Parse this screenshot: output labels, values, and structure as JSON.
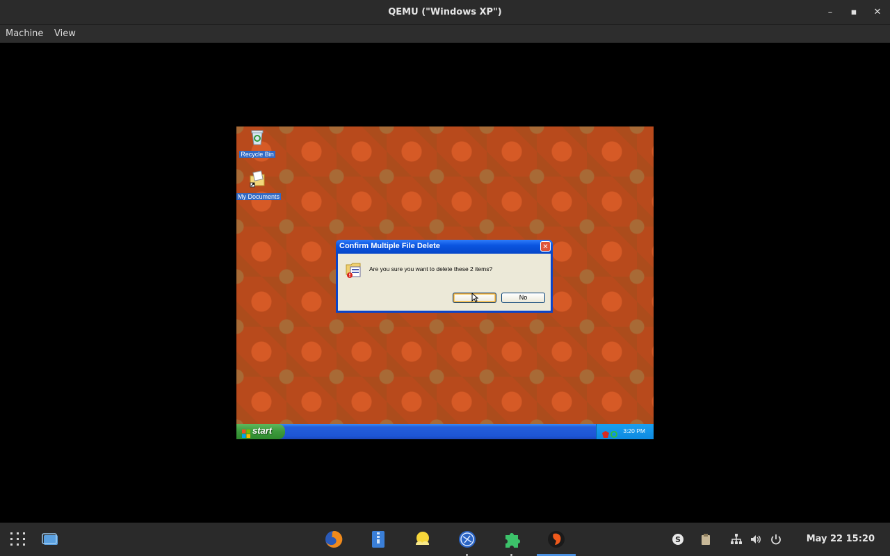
{
  "window": {
    "title": "QEMU (\"Windows XP\")",
    "minimize_label": "–",
    "maximize_label": "▪",
    "close_label": "✕"
  },
  "menubar": {
    "items": [
      "Machine",
      "View"
    ]
  },
  "guest": {
    "desktop_icons": [
      {
        "label": "Recycle Bin",
        "icon": "recycle-bin-icon"
      },
      {
        "label": "My Documents",
        "icon": "my-documents-icon"
      }
    ],
    "dialog": {
      "title": "Confirm Multiple File Delete",
      "close_label": "✕",
      "message": "Are you sure you want to delete these 2 items?",
      "yes_label": "",
      "no_label": "No"
    },
    "taskbar": {
      "start_label": "start",
      "time": "3:20 PM"
    }
  },
  "host_panel": {
    "apps": [
      {
        "name": "firefox",
        "icon": "firefox-icon"
      },
      {
        "name": "files",
        "icon": "files-icon"
      },
      {
        "name": "weather",
        "icon": "weather-icon"
      },
      {
        "name": "browser",
        "icon": "globe-icon"
      },
      {
        "name": "extensions",
        "icon": "puzzle-icon"
      },
      {
        "name": "qemu",
        "icon": "qemu-icon"
      }
    ],
    "clock": "May 22  15:20"
  }
}
